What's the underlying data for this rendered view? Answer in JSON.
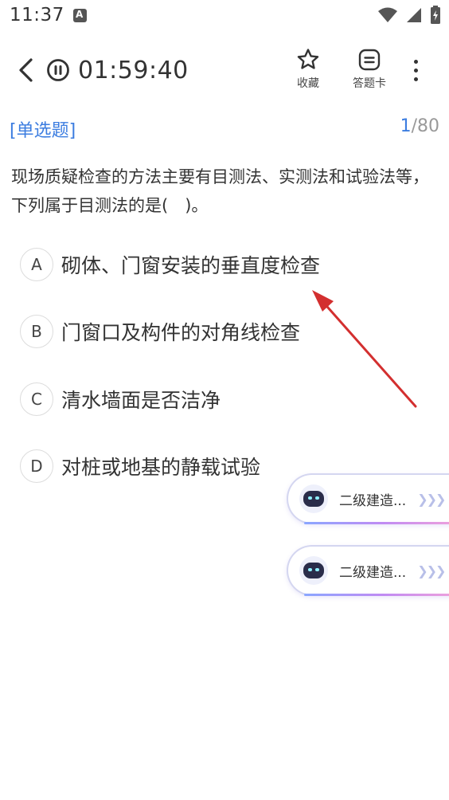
{
  "status_bar": {
    "time": "11:37"
  },
  "header": {
    "timer": "01:59:40",
    "favorite_label": "收藏",
    "answer_card_label": "答题卡"
  },
  "question": {
    "type_label": "[单选题]",
    "current_index": "1",
    "total_label": "/80",
    "stem": "现场质疑检查的方法主要有目测法、实测法和试验法等，下列属于目测法的是(　)。",
    "options": [
      {
        "letter": "A",
        "text": "砌体、门窗安装的垂直度检查"
      },
      {
        "letter": "B",
        "text": "门窗口及构件的对角线检查"
      },
      {
        "letter": "C",
        "text": "清水墙面是否洁净"
      },
      {
        "letter": "D",
        "text": "对桩或地基的静载试验"
      }
    ]
  },
  "assistant_pills": [
    {
      "label": "二级建造..."
    },
    {
      "label": "二级建造..."
    }
  ],
  "colors": {
    "accent": "#3c7de0",
    "annotation_arrow": "#d32f2f"
  },
  "icons": [
    "app-notification-icon",
    "wifi-icon",
    "cell-signal-icon",
    "battery-icon",
    "back-arrow-icon",
    "pause-icon",
    "star-icon",
    "answer-card-icon",
    "more-vertical-icon",
    "robot-avatar-icon",
    "chevrons-right-icon"
  ]
}
